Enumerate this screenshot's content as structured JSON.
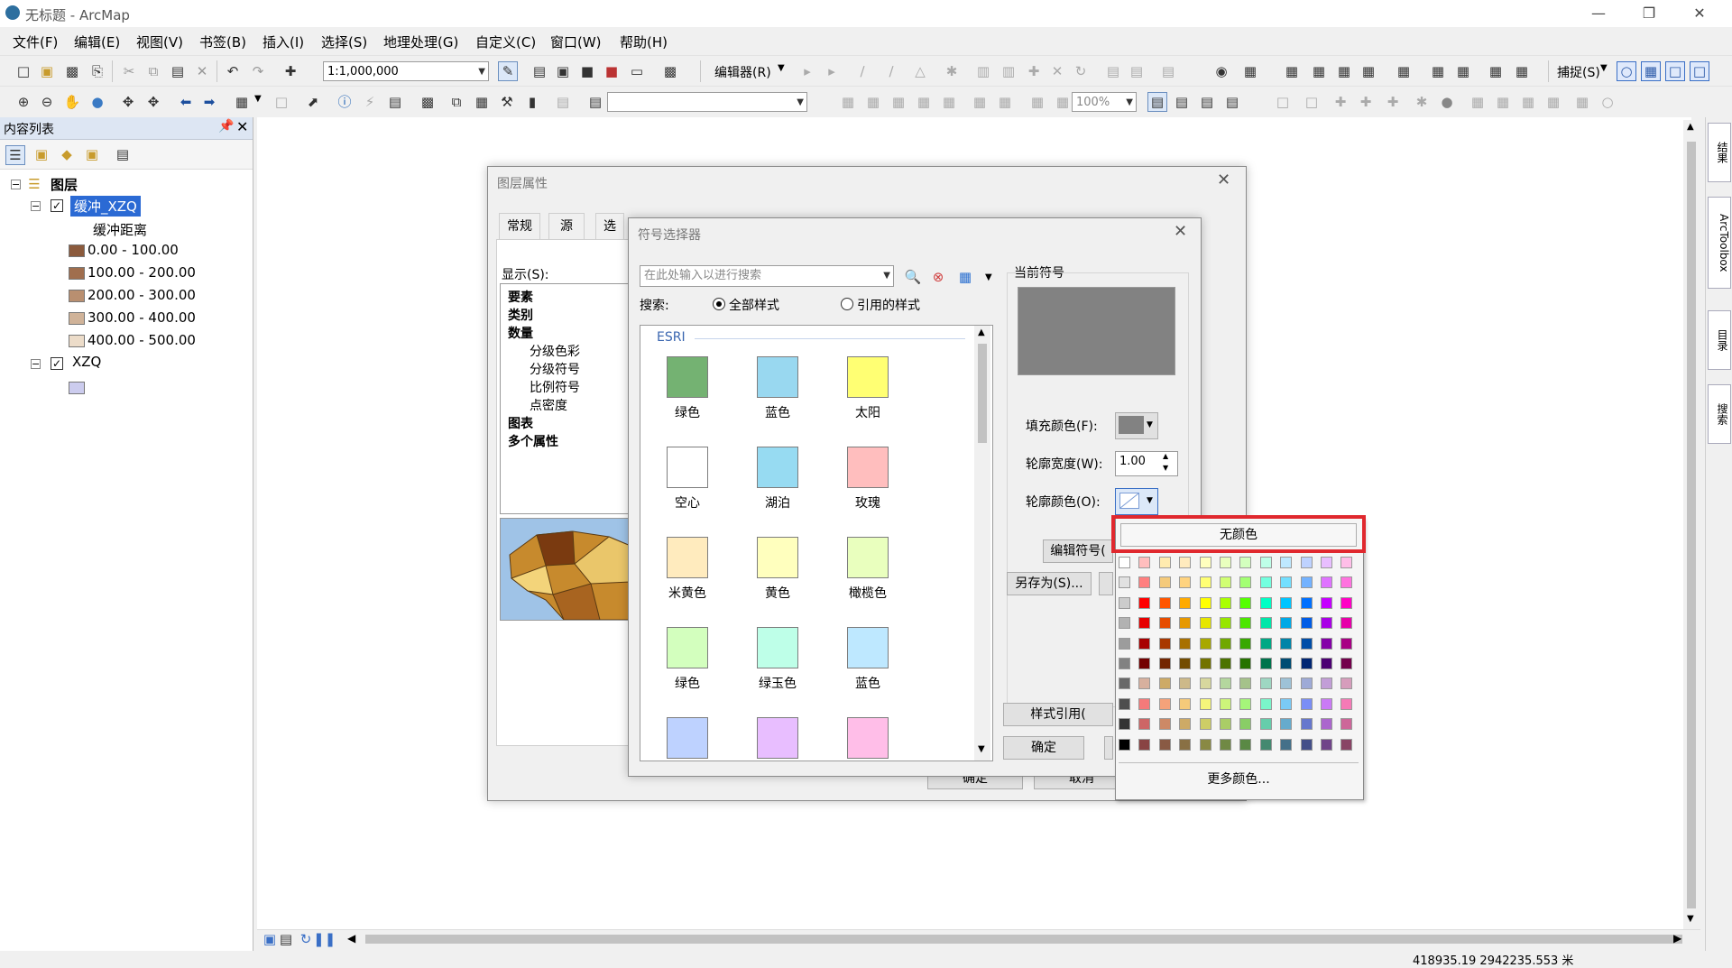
{
  "window": {
    "title": "无标题 - ArcMap"
  },
  "menu": [
    "文件(F)",
    "编辑(E)",
    "视图(V)",
    "书签(B)",
    "插入(I)",
    "选择(S)",
    "地理处理(G)",
    "自定义(C)",
    "窗口(W)",
    "帮助(H)"
  ],
  "toolbar": {
    "scale": "1:1,000,000",
    "editor_label": "编辑器(R)",
    "snap_label": "捕捉(S)",
    "zoom_percent": "100%"
  },
  "toc": {
    "header": "内容列表",
    "root_label": "图层",
    "layers": [
      {
        "name": "缓冲_XZQ",
        "field": "缓冲距离",
        "classes": [
          {
            "label": "0.00 - 100.00",
            "color": "#8b5a3c"
          },
          {
            "label": "100.00 - 200.00",
            "color": "#a06e4e"
          },
          {
            "label": "200.00 - 300.00",
            "color": "#b98f70"
          },
          {
            "label": "300.00 - 400.00",
            "color": "#d0b399"
          },
          {
            "label": "400.00 - 500.00",
            "color": "#ecdcc9"
          }
        ]
      },
      {
        "name": "XZQ",
        "symbol_color": "#ccccee"
      }
    ]
  },
  "layer_props": {
    "title": "图层属性",
    "tabs": [
      "常规",
      "源",
      "选"
    ],
    "show_label": "显示(S):",
    "show_items": [
      "要素",
      "类别",
      "数量",
      "分级色彩",
      "分级符号",
      "比例符号",
      "点密度",
      "图表",
      "多个属性"
    ],
    "ok": "确定",
    "cancel": "取消"
  },
  "symbol_selector": {
    "title": "符号选择器",
    "search_placeholder": "在此处输入以进行搜索",
    "search_label": "搜索:",
    "radio_all": "全部样式",
    "radio_referenced": "引用的样式",
    "group_label": "ESRI",
    "symbols": [
      {
        "label": "绿色",
        "color": "#74b272"
      },
      {
        "label": "蓝色",
        "color": "#99d8f0"
      },
      {
        "label": "太阳",
        "color": "#ffff73"
      },
      {
        "label": "空心",
        "color": "#ffffff"
      },
      {
        "label": "湖泊",
        "color": "#97dbf2"
      },
      {
        "label": "玫瑰",
        "color": "#ffbebe"
      },
      {
        "label": "米黄色",
        "color": "#ffebbe"
      },
      {
        "label": "黄色",
        "color": "#ffffbe"
      },
      {
        "label": "橄榄色",
        "color": "#e9ffbe"
      },
      {
        "label": "绿色",
        "color": "#d3ffbe"
      },
      {
        "label": "绿玉色",
        "color": "#beffe8"
      },
      {
        "label": "蓝色",
        "color": "#bee8ff"
      },
      {
        "label": "",
        "color": "#bed2ff"
      },
      {
        "label": "",
        "color": "#e8beff"
      },
      {
        "label": "",
        "color": "#ffbee8"
      }
    ],
    "current_symbol_label": "当前符号",
    "current_symbol_color": "#828282",
    "fill_color_label": "填充颜色(F):",
    "outline_width_label": "轮廓宽度(W):",
    "outline_width_value": "1.00",
    "outline_color_label": "轮廓颜色(O):",
    "edit_symbol_button": "编辑符号(",
    "save_as_button": "另存为(S)...",
    "style_ref_button": "样式引用(",
    "ok_button": "确定"
  },
  "color_popup": {
    "no_color": "无颜色",
    "more_colors": "更多颜色...",
    "highlight_color": "#e0282e"
  },
  "status": {
    "coords": "418935.19  2942235.553 米"
  }
}
